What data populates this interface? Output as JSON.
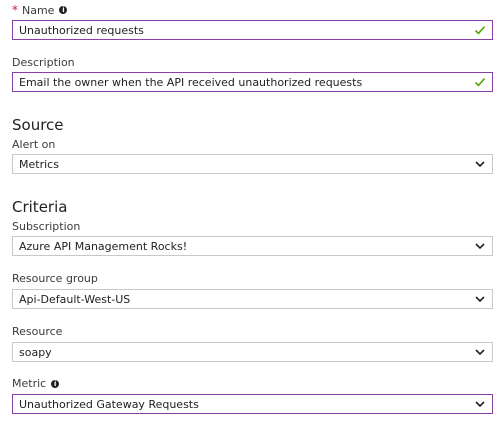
{
  "name": {
    "label": "Name",
    "required_mark": "*",
    "value": "Unauthorized requests"
  },
  "description": {
    "label": "Description",
    "value": "Email the owner when the API received unauthorized requests"
  },
  "source": {
    "title": "Source",
    "alert_on": {
      "label": "Alert on",
      "value": "Metrics"
    }
  },
  "criteria": {
    "title": "Criteria",
    "subscription": {
      "label": "Subscription",
      "value": "Azure API Management Rocks!"
    },
    "resource_group": {
      "label": "Resource group",
      "value": "Api-Default-West-US"
    },
    "resource": {
      "label": "Resource",
      "value": "soapy"
    },
    "metric": {
      "label": "Metric",
      "value": "Unauthorized Gateway Requests"
    }
  },
  "colors": {
    "active_border": "#8a3fa8",
    "check": "#57a300",
    "required": "#c4262e"
  },
  "icons": {
    "info": "info-icon",
    "valid": "check-icon",
    "dropdown": "chevron-down-icon"
  }
}
